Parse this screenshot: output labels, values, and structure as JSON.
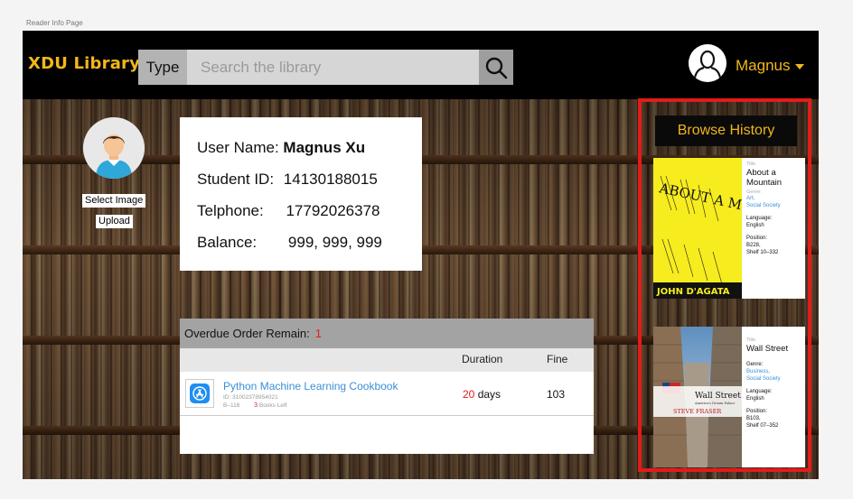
{
  "page_caption": "Reader Info Page",
  "header": {
    "logo": "XDU Library",
    "type_label": "Type",
    "search_placeholder": "Search the library",
    "user_name": "Magnus"
  },
  "profile": {
    "select_image_label": "Select Image",
    "upload_label": "Upload",
    "user_name_label": "User Name:",
    "user_name_value": "Magnus Xu",
    "student_id_label": "Student ID:",
    "student_id_value": "14130188015",
    "telephone_label": "Telphone:",
    "telephone_value": "17792026378",
    "balance_label": "Balance:",
    "balance_value": "999, 999, 999"
  },
  "overdue": {
    "title": "Overdue Order Remain:",
    "count": "1",
    "col_duration": "Duration",
    "col_fine": "Fine",
    "orders": [
      {
        "title": "Python Machine Learning Cookbook",
        "id": "ID: 31002378954021",
        "location": "B–116",
        "books_left_count": "3",
        "books_left_label": "Books Left",
        "duration_value": "20",
        "duration_unit": "days",
        "fine": "103"
      }
    ]
  },
  "history": {
    "title": "Browse History",
    "books": [
      {
        "cover_title": "ABOUT A MOUNTAIN",
        "cover_author": "JOHN D'AGATA",
        "title_label": "Title",
        "title": "About a Mountain",
        "genre_label": "Genre:",
        "genres": [
          "Art,",
          "Social Society"
        ],
        "language_label": "Language:",
        "language": "English",
        "position_label": "Position:",
        "position_lines": [
          "B228,",
          "Shelf 10–332"
        ]
      },
      {
        "cover_title": "Wall Street",
        "cover_subtitle": "America's Dream Palace",
        "cover_author": "STEVE FRASER",
        "title_label": "Title",
        "title": "Wall Street",
        "genre_label": "Genre:",
        "genres": [
          "Business,",
          "Social Society"
        ],
        "language_label": "Language:",
        "language": "English",
        "position_label": "Position:",
        "position_lines": [
          "B103,",
          "Shelf 07–352"
        ]
      }
    ]
  },
  "colors": {
    "accent_gold": "#f2b71a",
    "highlight_red": "#e31b1b",
    "link_blue": "#3b8fd9",
    "alert_red": "#e02020"
  }
}
